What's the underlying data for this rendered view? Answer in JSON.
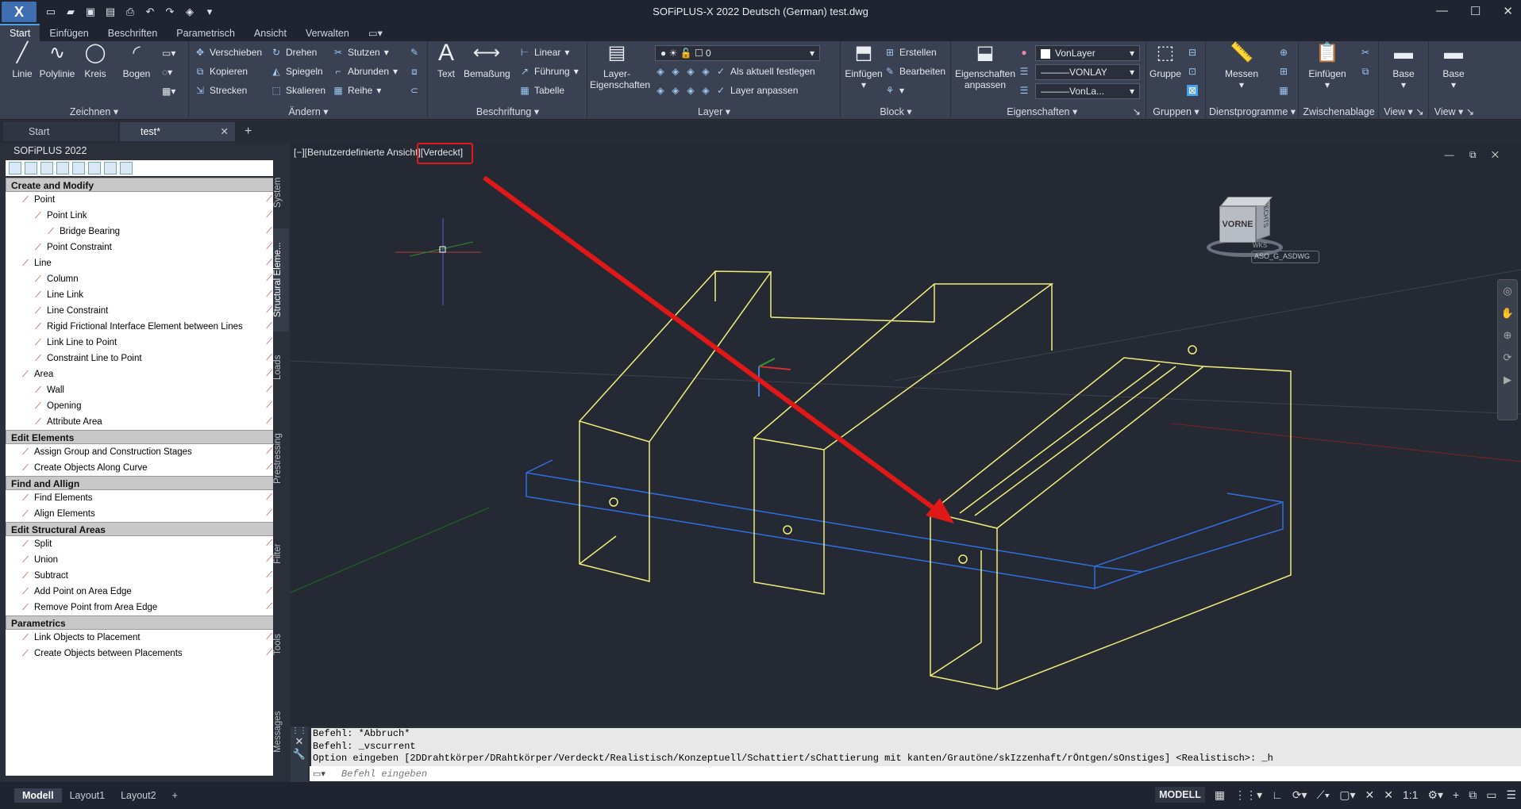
{
  "app": {
    "logo": "X",
    "title": "SOFiPLUS-X 2022 Deutsch (German)    test.dwg"
  },
  "ribbon_tabs": [
    "Start",
    "Einfügen",
    "Beschriften",
    "Parametrisch",
    "Ansicht",
    "Verwalten"
  ],
  "panels": {
    "zeichnen": {
      "label": "Zeichnen",
      "linie": "Linie",
      "polylinie": "Polylinie",
      "kreis": "Kreis",
      "bogen": "Bogen"
    },
    "aendern": {
      "label": "Ändern",
      "verschieben": "Verschieben",
      "drehen": "Drehen",
      "stutzen": "Stutzen",
      "kopieren": "Kopieren",
      "spiegeln": "Spiegeln",
      "abrunden": "Abrunden",
      "strecken": "Strecken",
      "skalieren": "Skalieren",
      "reihe": "Reihe"
    },
    "beschriftung": {
      "label": "Beschriftung",
      "text": "Text",
      "bemassung": "Bemaßung",
      "linear": "Linear",
      "fuehrung": "Führung",
      "tabelle": "Tabelle"
    },
    "layer": {
      "label": "Layer",
      "layer_eig_1": "Layer-",
      "layer_eig_2": "Eigenschaften",
      "layer_value": "0",
      "aktuell": "Als aktuell festlegen",
      "anpassen": "Layer anpassen"
    },
    "block": {
      "label": "Block",
      "einfuegen": "Einfügen",
      "erstellen": "Erstellen",
      "bearbeiten": "Bearbeiten"
    },
    "eigenschaften": {
      "label": "Eigenschaften",
      "eig_1": "Eigenschaften",
      "eig_2": "anpassen",
      "color": "VonLayer",
      "linetype": "VONLAY",
      "lineweight": "VonLa..."
    },
    "gruppen": {
      "label": "Gruppen",
      "gruppe": "Gruppe"
    },
    "dienst": {
      "label": "Dienstprogramme",
      "messen": "Messen"
    },
    "zwischen": {
      "label": "Zwischenablage",
      "einfuegen": "Einfügen"
    },
    "view1": {
      "label": "View",
      "base": "Base"
    },
    "view2": {
      "label": "View",
      "base": "Base"
    }
  },
  "doc_tabs": {
    "start": "Start",
    "test": "test*"
  },
  "palette": {
    "title": "SOFiPLUS 2022",
    "sections": [
      {
        "title": "Create and Modify",
        "items": [
          {
            "label": "Point",
            "indent": 1
          },
          {
            "label": "Point Link",
            "indent": 2
          },
          {
            "label": "Bridge Bearing",
            "indent": 3
          },
          {
            "label": "Point Constraint",
            "indent": 2
          },
          {
            "label": "Line",
            "indent": 1
          },
          {
            "label": "Column",
            "indent": 2
          },
          {
            "label": "Line Link",
            "indent": 2
          },
          {
            "label": "Line Constraint",
            "indent": 2
          },
          {
            "label": "Rigid Frictional Interface Element between Lines",
            "indent": 2
          },
          {
            "label": "Link Line to Point",
            "indent": 2
          },
          {
            "label": "Constraint Line to Point",
            "indent": 2
          },
          {
            "label": "Area",
            "indent": 1
          },
          {
            "label": "Wall",
            "indent": 2
          },
          {
            "label": "Opening",
            "indent": 2
          },
          {
            "label": "Attribute Area",
            "indent": 2
          }
        ]
      },
      {
        "title": "Edit Elements",
        "items": [
          {
            "label": "Assign Group and Construction Stages",
            "indent": 1
          },
          {
            "label": "Create Objects Along Curve",
            "indent": 1
          }
        ]
      },
      {
        "title": "Find and Allign",
        "items": [
          {
            "label": "Find Elements",
            "indent": 1
          },
          {
            "label": "Align Elements",
            "indent": 1
          }
        ]
      },
      {
        "title": "Edit Structural Areas",
        "items": [
          {
            "label": "Split",
            "indent": 1
          },
          {
            "label": "Union",
            "indent": 1
          },
          {
            "label": "Subtract",
            "indent": 1
          },
          {
            "label": "Add Point on Area Edge",
            "indent": 1
          },
          {
            "label": "Remove Point from Area Edge",
            "indent": 1
          }
        ]
      },
      {
        "title": "Parametrics",
        "items": [
          {
            "label": "Link Objects to Placement",
            "indent": 1
          },
          {
            "label": "Create Objects between Placements",
            "indent": 1
          }
        ]
      }
    ]
  },
  "side_tabs": [
    "System",
    "Structural Eleme...",
    "Loads",
    "Prestressing",
    "Filter",
    "Tools",
    "Messages"
  ],
  "viewport": {
    "label_prefix": "[−][Benutzerdefinierte Ansicht]",
    "style": "[Verdeckt]",
    "viewcube_face": "VORNE",
    "viewcube_side": "RECHTS",
    "wks": "WKS",
    "ucs": "ASO_G_ASDWG"
  },
  "command": {
    "lines": [
      "Befehl: *Abbruch*",
      "Befehl: _vscurrent",
      "Option eingeben [2DDrahtkörper/DRahtkörper/Verdeckt/Realistisch/Konzeptuell/Schattiert/sChattierung mit kanten/Grautöne/skIzzenhaft/rÖntgen/sOnstiges] <Realistisch>: _h"
    ],
    "placeholder": "Befehl eingeben"
  },
  "status": {
    "tabs": [
      "Modell",
      "Layout1",
      "Layout2"
    ],
    "model": "MODELL",
    "scale": "1:1"
  },
  "colors": {
    "accent": "#4aa3e8",
    "annotation": "#e01818",
    "solid_yellow": "#f2ee7a",
    "slab_blue": "#2f6fe0"
  }
}
